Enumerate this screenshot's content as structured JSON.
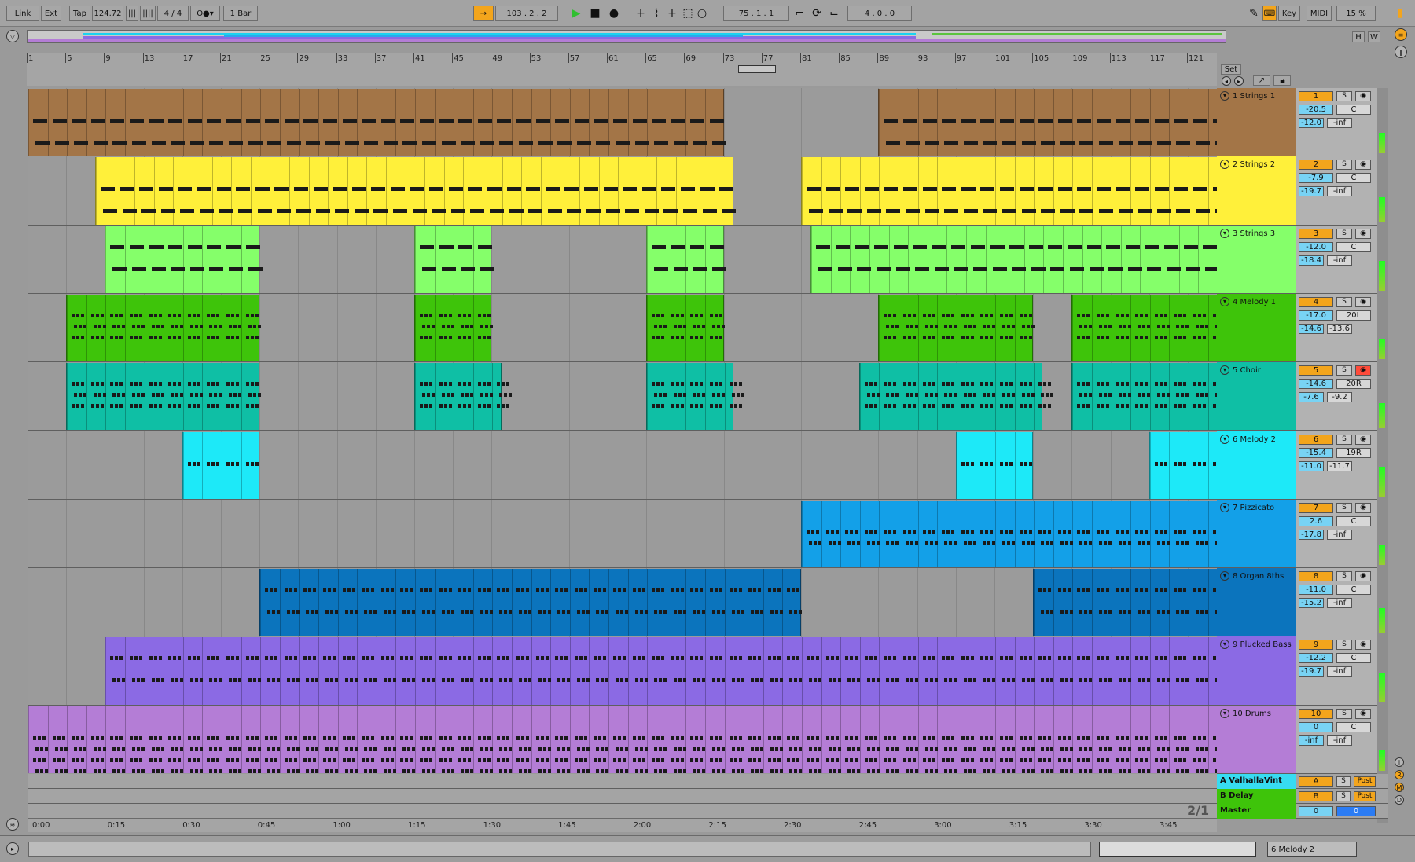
{
  "transport": {
    "link": "Link",
    "ext": "Ext",
    "tap": "Tap",
    "tempo": "124.72",
    "time_signature": "4 / 4",
    "quantize": "1 Bar",
    "position": "103 .  2 .  2",
    "loop_start": "75 .  1 .  1",
    "loop_length": "4 .  0 .  0",
    "key": "Key",
    "midi": "MIDI",
    "zoom": "15 %"
  },
  "overview": {
    "h_button": "H",
    "w_button": "W"
  },
  "ruler": {
    "bars": [
      "1",
      "5",
      "9",
      "13",
      "17",
      "21",
      "25",
      "29",
      "33",
      "37",
      "41",
      "45",
      "49",
      "53",
      "57",
      "61",
      "65",
      "69",
      "73",
      "77",
      "81",
      "85",
      "89",
      "93",
      "97",
      "101",
      "105",
      "109",
      "113",
      "117",
      "121"
    ],
    "set_label": "Set"
  },
  "time_ruler": [
    "0:00",
    "0:15",
    "0:30",
    "0:45",
    "1:00",
    "1:15",
    "1:30",
    "1:45",
    "2:00",
    "2:15",
    "2:30",
    "2:45",
    "3:00",
    "3:15",
    "3:30",
    "3:45"
  ],
  "tracks": [
    {
      "name": "1 Strings 1",
      "num": "1",
      "vol": "-20.5",
      "pan": "C",
      "send_a": "-12.0",
      "send_b": "-inf",
      "color": "#a37547"
    },
    {
      "name": "2 Strings 2",
      "num": "2",
      "vol": "-7.9",
      "pan": "C",
      "send_a": "-19.7",
      "send_b": "-inf",
      "color": "#fff03a"
    },
    {
      "name": "3 Strings 3",
      "num": "3",
      "vol": "-12.0",
      "pan": "C",
      "send_a": "-18.4",
      "send_b": "-inf",
      "color": "#85ff6a"
    },
    {
      "name": "4 Melody 1",
      "num": "4",
      "vol": "-17.0",
      "pan": "20L",
      "send_a": "-14.6",
      "send_b": "-13.6",
      "color": "#3ec40a"
    },
    {
      "name": "5 Choir",
      "num": "5",
      "vol": "-14.6",
      "pan": "20R",
      "send_a": "-7.6",
      "send_b": "-9.2",
      "color": "#0fbfa5"
    },
    {
      "name": "6 Melody 2",
      "num": "6",
      "vol": "-15.4",
      "pan": "19R",
      "send_a": "-11.0",
      "send_b": "-11.7",
      "color": "#1de9f8"
    },
    {
      "name": "7 Pizzicato",
      "num": "7",
      "vol": "2.6",
      "pan": "C",
      "send_a": "-17.8",
      "send_b": "-inf",
      "color": "#13a0e8"
    },
    {
      "name": "8 Organ 8ths",
      "num": "8",
      "vol": "-11.0",
      "pan": "C",
      "send_a": "-15.2",
      "send_b": "-inf",
      "color": "#0b74bd"
    },
    {
      "name": "9 Plucked Bass",
      "num": "9",
      "vol": "-12.2",
      "pan": "C",
      "send_a": "-19.7",
      "send_b": "-inf",
      "color": "#8b6ae4"
    },
    {
      "name": "10 Drums",
      "num": "10",
      "vol": "0",
      "pan": "C",
      "send_a": "-inf",
      "send_b": "-inf",
      "color": "#b47dd6"
    }
  ],
  "returns": [
    {
      "name": "A ValhallaVint",
      "num": "A",
      "s": "S",
      "post": "Post",
      "color": "#37dcf2"
    },
    {
      "name": "B Delay",
      "num": "B",
      "s": "S",
      "post": "Post",
      "color": "#3ec40a"
    },
    {
      "name": "Master",
      "num": "0",
      "vol": "0",
      "color": "#3ec40a"
    }
  ],
  "page_indicator": "2/1",
  "status": {
    "selected_track": "6 Melody 2"
  },
  "mixer_labels": {
    "solo": "S"
  }
}
